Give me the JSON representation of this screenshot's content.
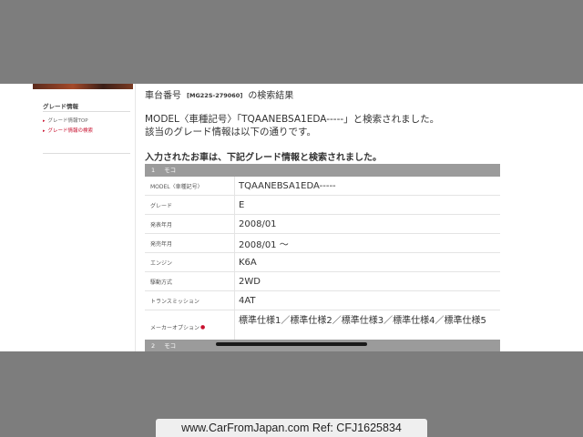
{
  "sidebar": {
    "heading": "グレード情報",
    "items": [
      {
        "label": "グレード情報TOP",
        "active": false
      },
      {
        "label": "グレード情報の検索",
        "active": true
      }
    ]
  },
  "main": {
    "title_prefix": "車台番号",
    "chassis": "[MG22S-279060]",
    "title_suffix": "の検索結果",
    "message_line1": "MODEL〈車種記号〉「TQAANEBSA1EDA-----」と検索されました。",
    "message_line2": "該当のグレード情報は以下の通りです。",
    "subheading": "入力されたお車は、下記グレード情報と検索されました。",
    "results": [
      {
        "num": "1",
        "name": "モコ"
      },
      {
        "num": "2",
        "name": "モコ"
      }
    ],
    "rows": [
      {
        "key": "MODEL〈車種記号〉",
        "value": "TQAANEBSA1EDA-----"
      },
      {
        "key": "グレード",
        "value": "E"
      },
      {
        "key": "発表年月",
        "value": "2008/01"
      },
      {
        "key": "発売年月",
        "value": "2008/01 〜"
      },
      {
        "key": "エンジン",
        "value": "K6A"
      },
      {
        "key": "駆動方式",
        "value": "2WD"
      },
      {
        "key": "トランスミッション",
        "value": "4AT"
      },
      {
        "key": "メーカーオプション",
        "required_mark": "●",
        "value": "標準仕様1／標準仕様2／標準仕様3／標準仕様4／標準仕様5"
      }
    ]
  },
  "watermark": "www.CarFromJapan.com Ref: CFJ1625834",
  "colors": {
    "accent": "#c8102e",
    "bar": "#9b9b9b",
    "letterbox": "#7d7d7d"
  }
}
